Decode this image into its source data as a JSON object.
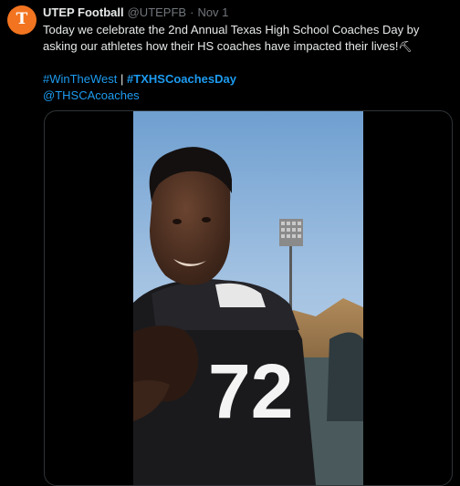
{
  "tweet": {
    "author_name": "UTEP Football",
    "handle": "@UTEPFB",
    "separator": "·",
    "date": "Nov 1",
    "text": "Today we celebrate the 2nd Annual Texas High School Coaches Day by asking our athletes how their HS coaches have impacted their lives!",
    "emoji": "⛏",
    "hashtag_1": "#WinTheWest",
    "tag_separator": "|",
    "hashtag_2": "#TXHSCoachesDay",
    "mention": "@THSCAcoaches",
    "avatar_glyph": "T"
  },
  "media": {
    "jersey_number": "72"
  },
  "colors": {
    "background": "#000000",
    "text": "#e7e9ea",
    "muted": "#71767b",
    "link": "#1d9bf0",
    "avatar": "#f27420"
  }
}
